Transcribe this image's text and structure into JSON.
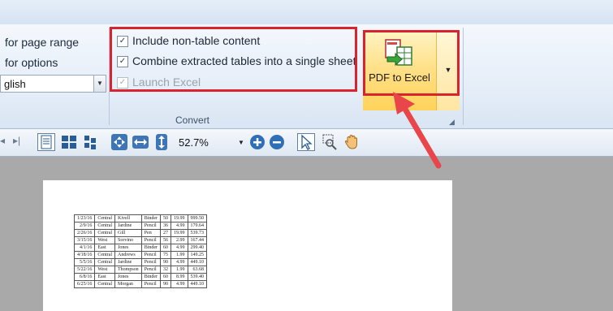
{
  "ribbon": {
    "left_labels": [
      "for page range",
      "for options"
    ],
    "language_value": "glish",
    "options": [
      {
        "label": "Include non-table content",
        "checked": true,
        "enabled": true
      },
      {
        "label": "Combine extracted tables into a single sheet",
        "checked": true,
        "enabled": true
      },
      {
        "label": "Launch Excel",
        "checked": true,
        "enabled": false
      }
    ],
    "group_label": "Convert",
    "pdf_to_excel_label": "PDF to Excel"
  },
  "toolbar": {
    "zoom": "52.7%"
  },
  "colors": {
    "highlight": "#d9242d",
    "button_fill": "#ffe18a"
  },
  "table_rows": [
    [
      "1/23/16",
      "Central",
      "Kivell",
      "Binder",
      "50",
      "19.99",
      "999.50"
    ],
    [
      "2/9/16",
      "Central",
      "Jardine",
      "Pencil",
      "36",
      "4.99",
      "179.64"
    ],
    [
      "2/26/16",
      "Central",
      "Gill",
      "Pen",
      "27",
      "19.99",
      "539.73"
    ],
    [
      "3/15/16",
      "West",
      "Sorvino",
      "Pencil",
      "56",
      "2.99",
      "167.44"
    ],
    [
      "4/1/16",
      "East",
      "Jones",
      "Binder",
      "60",
      "4.99",
      "299.40"
    ],
    [
      "4/18/16",
      "Central",
      "Andrews",
      "Pencil",
      "75",
      "1.99",
      "149.25"
    ],
    [
      "5/5/16",
      "Central",
      "Jardine",
      "Pencil",
      "90",
      "4.99",
      "449.10"
    ],
    [
      "5/22/16",
      "West",
      "Thompson",
      "Pencil",
      "32",
      "1.99",
      "63.68"
    ],
    [
      "6/8/16",
      "East",
      "Jones",
      "Binder",
      "60",
      "8.99",
      "539.40"
    ],
    [
      "6/25/16",
      "Central",
      "Morgan",
      "Pencil",
      "90",
      "4.99",
      "449.10"
    ]
  ]
}
